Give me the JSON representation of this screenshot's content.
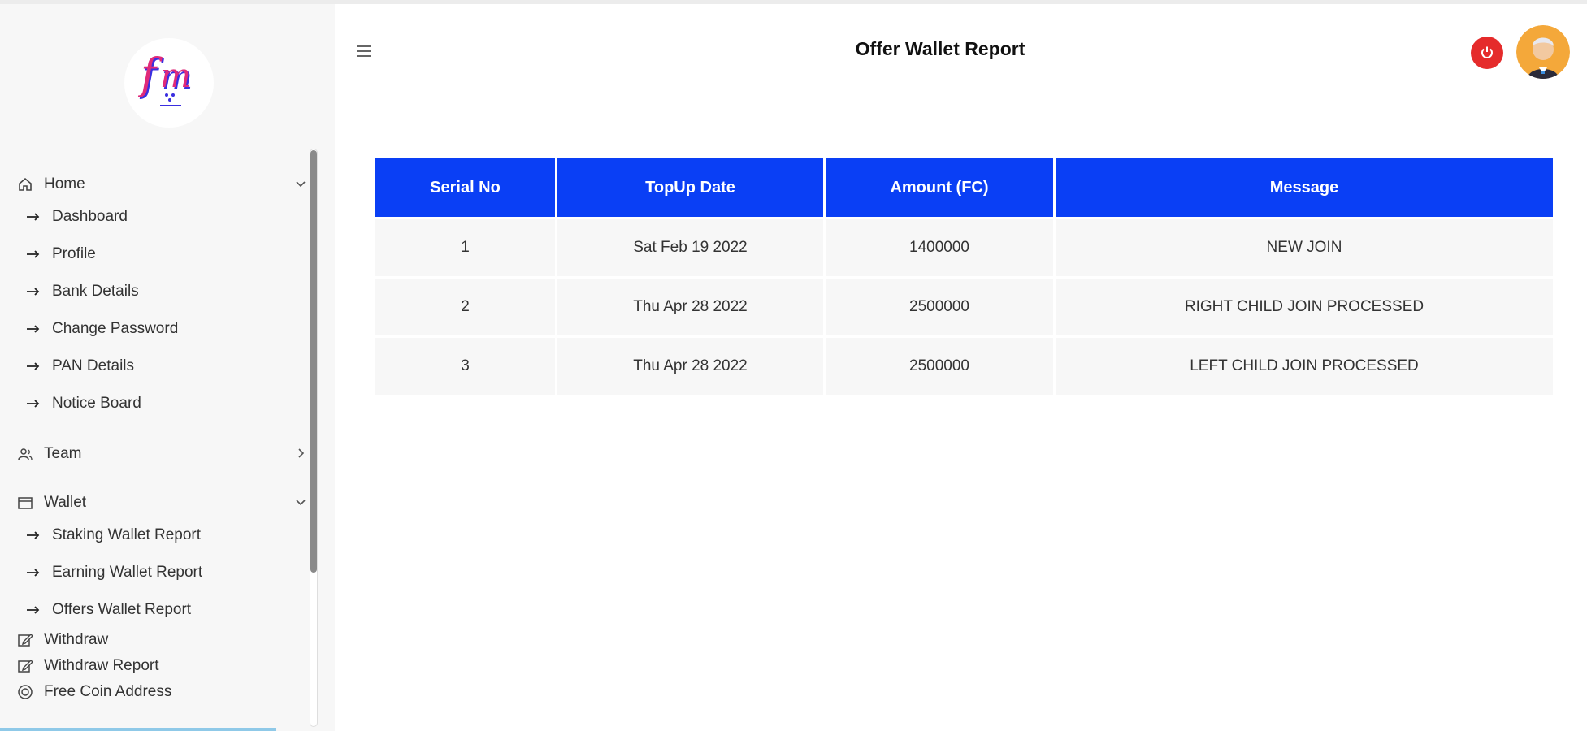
{
  "header": {
    "title": "Offer Wallet Report"
  },
  "sidebar": {
    "home": {
      "label": "Home",
      "items": [
        {
          "label": "Dashboard"
        },
        {
          "label": "Profile"
        },
        {
          "label": "Bank Details"
        },
        {
          "label": "Change Password"
        },
        {
          "label": "PAN Details"
        },
        {
          "label": "Notice Board"
        }
      ]
    },
    "team": {
      "label": "Team"
    },
    "wallet": {
      "label": "Wallet",
      "items": [
        {
          "label": "Staking Wallet Report"
        },
        {
          "label": "Earning Wallet Report"
        },
        {
          "label": "Offers Wallet Report"
        }
      ]
    },
    "withdraw": {
      "label": "Withdraw"
    },
    "withdraw_report": {
      "label": "Withdraw Report"
    },
    "free_coin_address": {
      "label": "Free Coin Address"
    }
  },
  "table": {
    "columns": [
      "Serial No",
      "TopUp Date",
      "Amount (FC)",
      "Message"
    ],
    "rows": [
      [
        "1",
        "Sat Feb 19 2022",
        "1400000",
        "NEW JOIN"
      ],
      [
        "2",
        "Thu Apr 28 2022",
        "2500000",
        "RIGHT CHILD JOIN PROCESSED"
      ],
      [
        "3",
        "Thu Apr 28 2022",
        "2500000",
        "LEFT CHILD JOIN PROCESSED"
      ]
    ]
  },
  "colors": {
    "table_header": "#0a3ff5",
    "power_button": "#e52b2b",
    "logo_primary": "#e02a7a",
    "logo_secondary": "#3a2ee0"
  },
  "icons": {
    "menu": "hamburger-icon",
    "power": "power-icon",
    "home": "home-icon",
    "team": "team-icon",
    "wallet": "wallet-icon",
    "withdraw": "edit-icon",
    "free_coin": "coin-icon"
  }
}
